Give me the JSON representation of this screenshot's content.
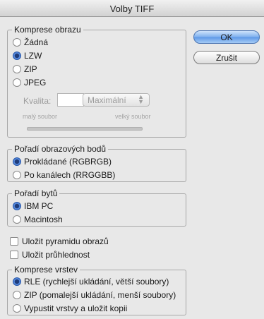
{
  "window": {
    "title": "Volby TIFF"
  },
  "buttons": {
    "ok": "OK",
    "cancel": "Zrušit"
  },
  "compression": {
    "legend": "Komprese obrazu",
    "options": [
      "Žádná",
      "LZW",
      "ZIP",
      "JPEG"
    ],
    "selected": "LZW",
    "quality_label": "Kvalita:",
    "quality_value": "",
    "quality_popup": "Maximální",
    "small_file": "malý soubor",
    "large_file": "velký soubor"
  },
  "pixel_order": {
    "legend": "Pořadí obrazových bodů",
    "options": [
      "Prokládané (RGBRGB)",
      "Po kanálech (RRGGBB)"
    ],
    "selected": "Prokládané (RGBRGB)"
  },
  "byte_order": {
    "legend": "Pořadí bytů",
    "options": [
      "IBM PC",
      "Macintosh"
    ],
    "selected": "IBM PC"
  },
  "checkboxes": {
    "save_pyramid": {
      "label": "Uložit pyramidu obrazů",
      "checked": false
    },
    "save_transparency": {
      "label": "Uložit průhlednost",
      "checked": false
    }
  },
  "layer_compression": {
    "legend": "Komprese vrstev",
    "options": [
      "RLE (rychlejší ukládání, větší soubory)",
      "ZIP (pomalejší ukládání, menší soubory)",
      "Vypustit vrstvy a uložit kopii"
    ],
    "selected": "RLE (rychlejší ukládání, větší soubory)"
  },
  "colors": {
    "accent": "#3d74d6",
    "window_bg": "#e8e8e8",
    "border": "#a8a8a8"
  },
  "icons": {
    "popup_arrows": "up-down-arrows-icon"
  }
}
